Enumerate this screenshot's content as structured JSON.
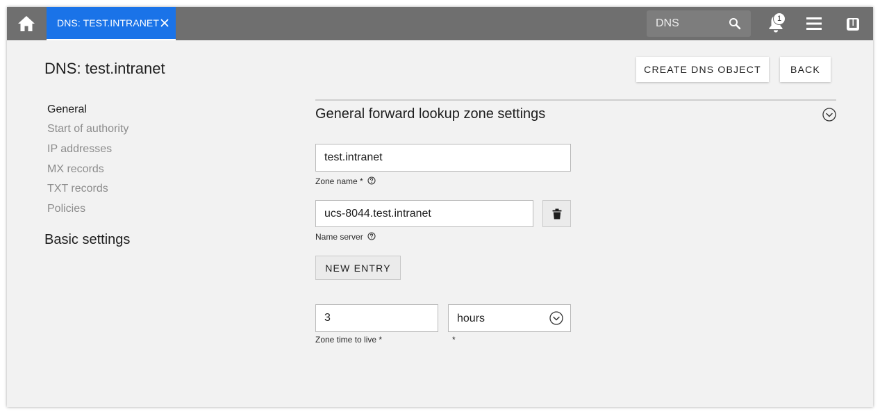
{
  "topbar": {
    "tab_label": "DNS: TEST.INTRANET",
    "search_value": "DNS",
    "notification_count": "1",
    "icons": {
      "home": "home-icon",
      "close": "close-icon",
      "search": "search-icon",
      "bell": "bell-icon",
      "menu": "menu-icon",
      "brand": "univention-icon"
    }
  },
  "header": {
    "title": "DNS: test.intranet",
    "create_button": "CREATE DNS OBJECT",
    "back_button": "BACK"
  },
  "sidebar": {
    "items": [
      {
        "label": "General",
        "active": true
      },
      {
        "label": "Start of authority",
        "active": false
      },
      {
        "label": "IP addresses",
        "active": false
      },
      {
        "label": "MX records",
        "active": false
      },
      {
        "label": "TXT records",
        "active": false
      },
      {
        "label": "Policies",
        "active": false
      }
    ],
    "basic_settings": "Basic settings"
  },
  "section": {
    "title": "General forward lookup zone settings",
    "zone_name": {
      "value": "test.intranet",
      "label": "Zone name *"
    },
    "name_server": {
      "value": "ucs-8044.test.intranet",
      "label": "Name server"
    },
    "new_entry_button": "NEW ENTRY",
    "ttl": {
      "value": "3",
      "label": "Zone time to live *"
    },
    "ttl_unit": {
      "value": "hours",
      "label": "*"
    }
  },
  "colors": {
    "topbar": "#6f6f6f",
    "tab_accent": "#1a73e8",
    "page_background": "#f2f2f2",
    "inactive_nav": "#8c8c8c"
  }
}
